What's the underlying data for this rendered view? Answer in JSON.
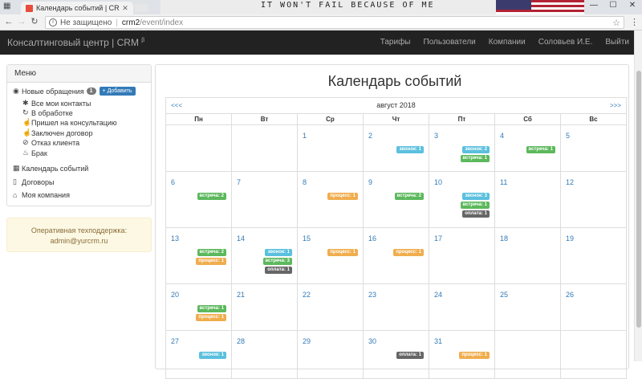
{
  "browser": {
    "tab_title": "Календарь событий | CR",
    "photo_text": "IT WON'T FAIL BECAUSE OF ME",
    "security_text": "Не защищено",
    "url_host": "crm2",
    "url_path": "/event/index"
  },
  "navbar": {
    "brand": "Консалтинговый центр | CRM",
    "brand_sup": "β",
    "links": [
      "Тарифы",
      "Пользователи",
      "Компании",
      "Соловьев И.Е.",
      "Выйти"
    ]
  },
  "sidebar": {
    "heading": "Меню",
    "new_requests": {
      "label": "Новые обращения",
      "count": "1",
      "add_label": "+ Добавить"
    },
    "sub_items": [
      {
        "icon": "asterisk-icon",
        "glyph": "✱",
        "label": "Все мои контакты"
      },
      {
        "icon": "refresh-icon",
        "glyph": "↻",
        "label": "В обработке"
      },
      {
        "icon": "thumbs-up-icon",
        "glyph": "☝",
        "label": "Пришел на консультацию"
      },
      {
        "icon": "thumbs-up-icon",
        "glyph": "☝",
        "label": "Заключен договор"
      },
      {
        "icon": "ban-icon",
        "glyph": "⊘",
        "label": "Отказ клиента"
      },
      {
        "icon": "fire-icon",
        "glyph": "♨",
        "label": "Брак"
      }
    ],
    "items": [
      {
        "icon": "calendar-icon",
        "glyph": "▦",
        "label": "Календарь событий"
      },
      {
        "icon": "file-icon",
        "glyph": "▯",
        "label": "Договоры"
      },
      {
        "icon": "home-icon",
        "glyph": "⌂",
        "label": "Моя компания"
      }
    ],
    "support": {
      "line1": "Оперативная техподдержка:",
      "line2": "admin@yurcrm.ru"
    }
  },
  "calendar": {
    "title": "Календарь событий",
    "prev": "<<<",
    "next": ">>>",
    "month": "август 2018",
    "weekdays": [
      "Пн",
      "Вт",
      "Ср",
      "Чт",
      "Пт",
      "Сб",
      "Вс"
    ],
    "colors": {
      "звонок": "#5bc0de",
      "встреча": "#5cb85c",
      "процесс": "#f0ad4e",
      "оплата": "#666666"
    },
    "weeks": [
      [
        {
          "day": ""
        },
        {
          "day": ""
        },
        {
          "day": "1"
        },
        {
          "day": "2",
          "events": [
            [
              "звонок",
              "звонок: 1"
            ]
          ]
        },
        {
          "day": "3",
          "events": [
            [
              "звонок",
              "звонок: 2"
            ],
            [
              "встреча",
              "встреча: 1"
            ]
          ]
        },
        {
          "day": "4",
          "events": [
            [
              "встреча",
              "встреча: 1"
            ]
          ]
        },
        {
          "day": "5"
        }
      ],
      [
        {
          "day": "6",
          "events": [
            [
              "встреча",
              "встреча: 2"
            ]
          ]
        },
        {
          "day": "7"
        },
        {
          "day": "8",
          "events": [
            [
              "процесс",
              "процесс: 1"
            ]
          ]
        },
        {
          "day": "9",
          "events": [
            [
              "встреча",
              "встреча: 2"
            ]
          ]
        },
        {
          "day": "10",
          "events": [
            [
              "звонок",
              "звонок: 3"
            ],
            [
              "встреча",
              "встреча: 1"
            ],
            [
              "оплата",
              "оплата: 1"
            ]
          ]
        },
        {
          "day": "11"
        },
        {
          "day": "12"
        }
      ],
      [
        {
          "day": "13",
          "events": [
            [
              "встреча",
              "встреча: 2"
            ],
            [
              "процесс",
              "процесс: 1"
            ]
          ]
        },
        {
          "day": "14",
          "events": [
            [
              "звонок",
              "звонок: 1"
            ],
            [
              "встреча",
              "встреча: 3"
            ],
            [
              "оплата",
              "оплата: 1"
            ]
          ]
        },
        {
          "day": "15",
          "events": [
            [
              "процесс",
              "процесс: 1"
            ]
          ]
        },
        {
          "day": "16",
          "events": [
            [
              "процесс",
              "процесс: 1"
            ]
          ]
        },
        {
          "day": "17"
        },
        {
          "day": "18"
        },
        {
          "day": "19"
        }
      ],
      [
        {
          "day": "20",
          "events": [
            [
              "встреча",
              "встреча: 1"
            ],
            [
              "процесс",
              "процесс: 1"
            ]
          ]
        },
        {
          "day": "21"
        },
        {
          "day": "22"
        },
        {
          "day": "23"
        },
        {
          "day": "24"
        },
        {
          "day": "25"
        },
        {
          "day": "26"
        }
      ],
      [
        {
          "day": "27",
          "events": [
            [
              "звонок",
              "звонок: 1"
            ]
          ]
        },
        {
          "day": "28"
        },
        {
          "day": "29"
        },
        {
          "day": "30",
          "events": [
            [
              "оплата",
              "оплата: 1"
            ]
          ]
        },
        {
          "day": "31",
          "events": [
            [
              "процесс",
              "процесс: 1"
            ]
          ]
        },
        {
          "day": ""
        },
        {
          "day": ""
        }
      ]
    ]
  }
}
